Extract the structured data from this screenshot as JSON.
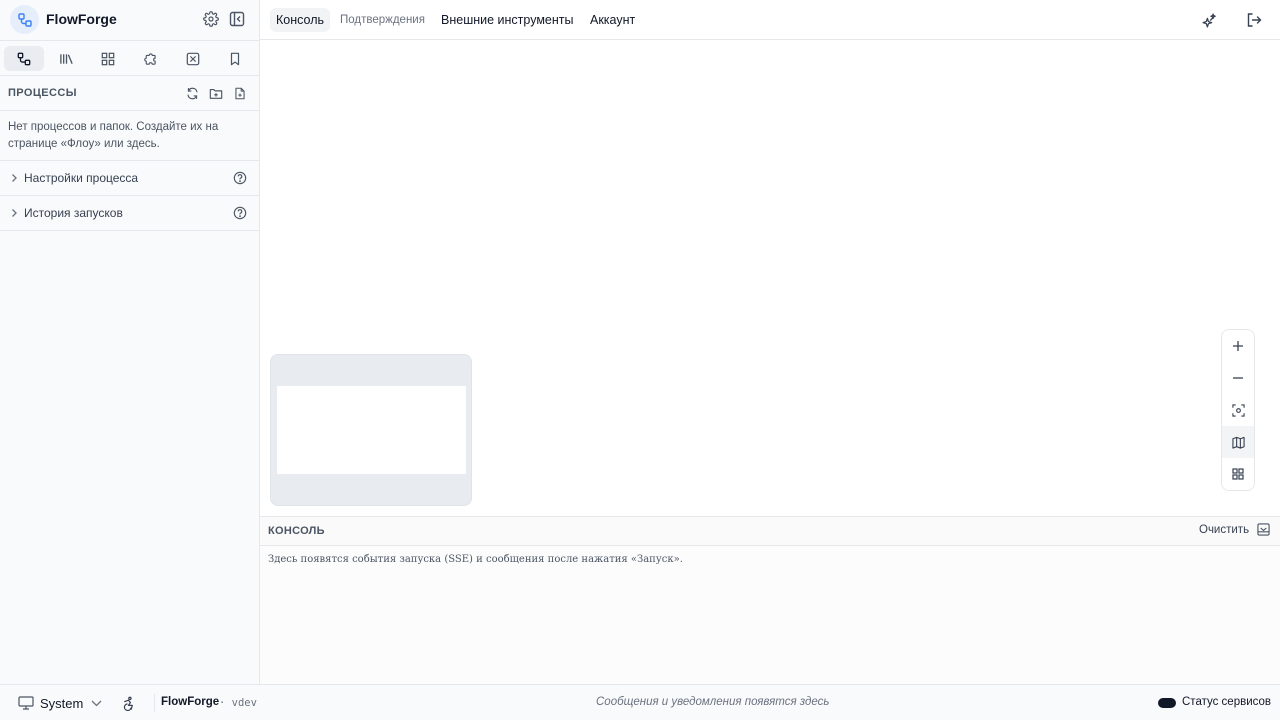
{
  "app": {
    "name": "FlowForge"
  },
  "sidebar": {
    "tabs": [
      {
        "icon": "flows-icon",
        "active": true
      },
      {
        "icon": "library-icon",
        "active": false
      },
      {
        "icon": "grid-icon",
        "active": false
      },
      {
        "icon": "puzzle-icon",
        "active": false
      },
      {
        "icon": "tools-icon",
        "active": false
      },
      {
        "icon": "bookmark-icon",
        "active": false
      }
    ],
    "processes": {
      "title": "ПРОЦЕССЫ",
      "empty": "Нет процессов и папок. Создайте их на странице «Флоу» или здесь."
    },
    "sections": [
      {
        "label": "Настройки процесса"
      },
      {
        "label": "История запусков"
      }
    ]
  },
  "topbar": {
    "tabs": [
      {
        "label": "Консоль",
        "active": true
      },
      {
        "label": "Подтверждения",
        "muted": true
      },
      {
        "label": "Внешние инструменты"
      },
      {
        "label": "Аккаунт"
      }
    ]
  },
  "console": {
    "title": "КОНСОЛЬ",
    "clear_label": "Очистить",
    "empty_message": "Здесь появятся события запуска (SSE) и сообщения после нажатия «Запуск»."
  },
  "statusbar": {
    "theme": "System",
    "brand": "FlowForge",
    "version": "· vdev",
    "message": "Сообщения и уведомления появятся здесь",
    "services": "Статус сервисов"
  },
  "colors": {
    "accent": "#3b82f6",
    "sidebar_bg": "#f9fafb",
    "border": "#e5e7eb"
  }
}
